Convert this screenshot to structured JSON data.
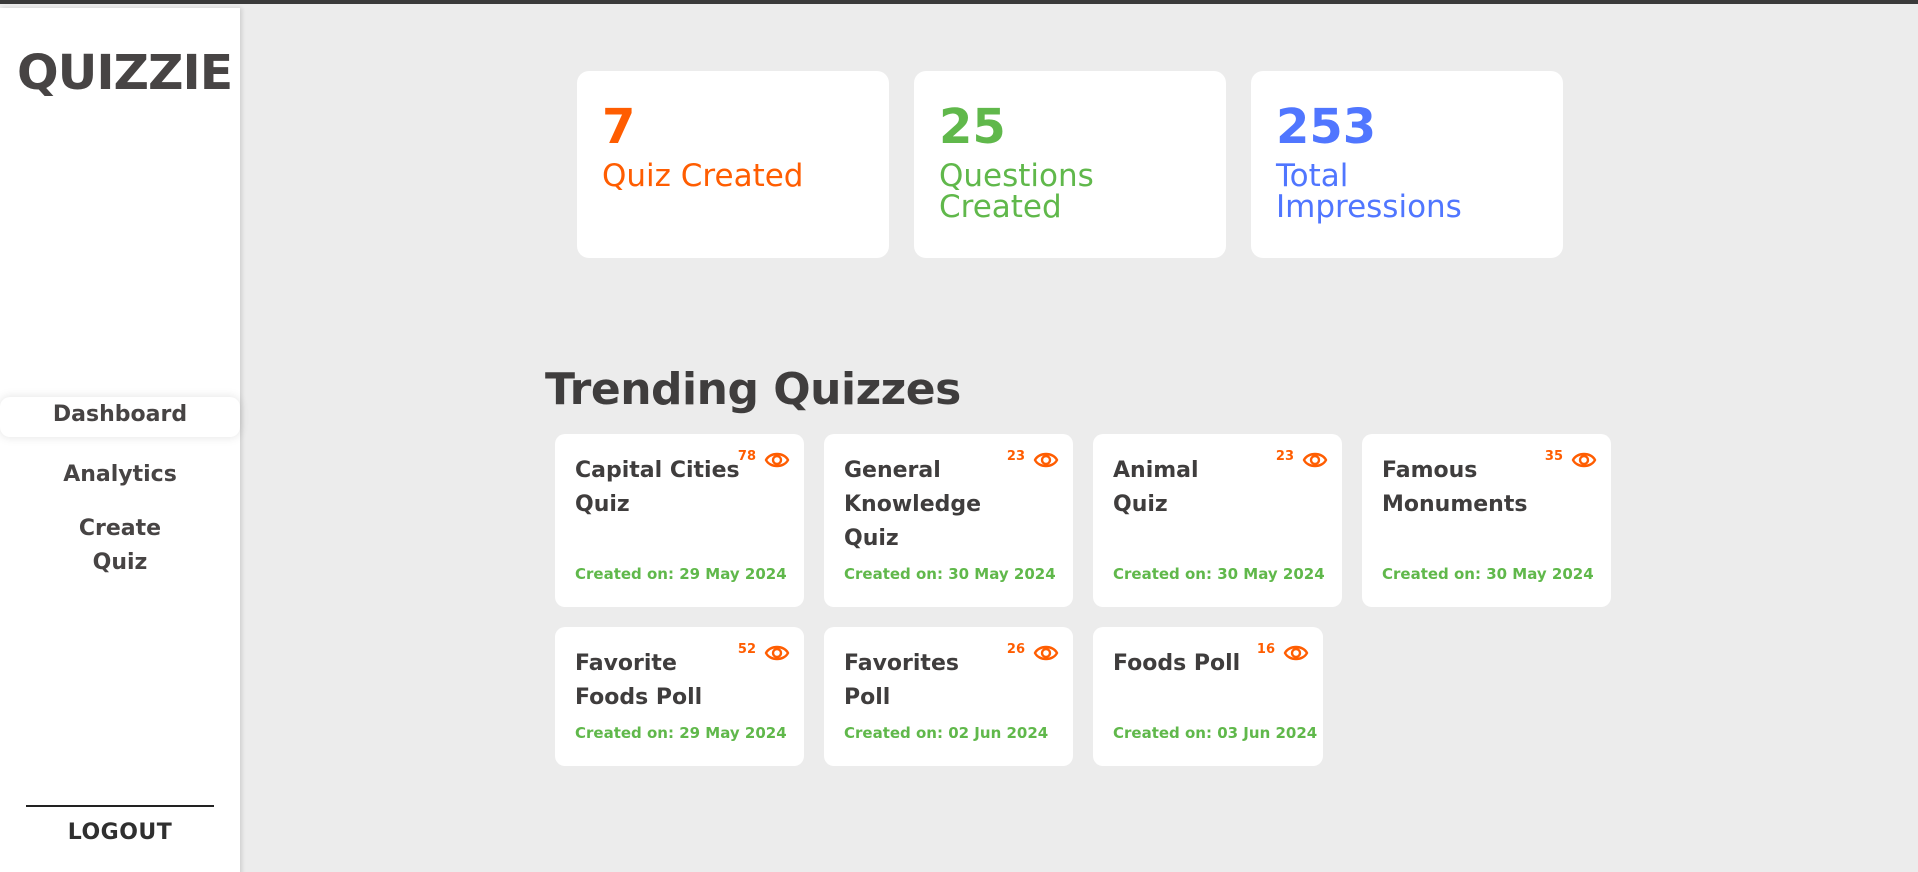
{
  "logo": "QUIZZIE",
  "nav": {
    "dashboard": "Dashboard",
    "analytics": "Analytics",
    "create_quiz_line1": "Create",
    "create_quiz_line2": "Quiz",
    "logout": "LOGOUT"
  },
  "stats": [
    {
      "value": "7",
      "label": "Quiz Created",
      "color": "#ff5d01"
    },
    {
      "value": "25",
      "label": "Questions Created",
      "color": "#60b84b"
    },
    {
      "value": "253",
      "label": "Total Impressions",
      "color": "#5076ff"
    }
  ],
  "trending_title": "Trending Quizzes",
  "quizzes": [
    {
      "name": "Capital Cities Quiz",
      "views": "78",
      "date": "Created on: 29 May 2024"
    },
    {
      "name": "General Knowledge Quiz",
      "views": "23",
      "date": "Created on: 30 May 2024"
    },
    {
      "name": "Animal Quiz",
      "views": "23",
      "date": "Created on: 30 May 2024"
    },
    {
      "name": "Famous Monuments",
      "views": "35",
      "date": "Created on: 30 May 2024"
    },
    {
      "name": "Favorite Foods Poll",
      "views": "52",
      "date": "Created on: 29 May 2024"
    },
    {
      "name": "Favorites Poll",
      "views": "26",
      "date": "Created on: 02 Jun 2024"
    },
    {
      "name": "Foods Poll",
      "views": "16",
      "date": "Created on: 03 Jun 2024"
    }
  ],
  "icons": {
    "views": "eye-icon"
  },
  "colors": {
    "accent_orange": "#ff5d01",
    "accent_green": "#60b84b",
    "accent_blue": "#5076ff"
  }
}
